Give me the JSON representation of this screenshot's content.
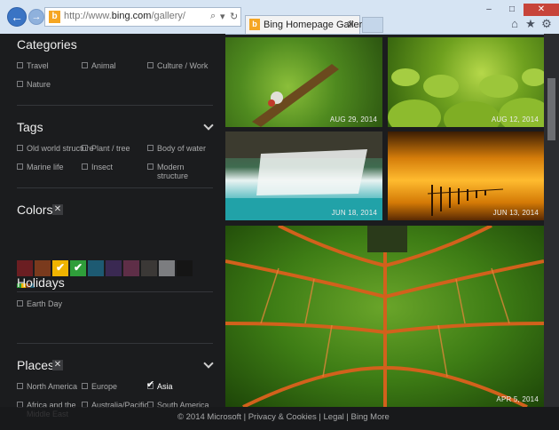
{
  "browser": {
    "address": {
      "prefix": "http://www.",
      "domain": "bing.com",
      "path": "/gallery/"
    },
    "tab_title": "Bing Homepage Gallery",
    "tab_favicon": "b",
    "address_favicon": "b",
    "back_glyph": "←",
    "forward_glyph": "→",
    "search_glyph": "⌕",
    "dropdown_glyph": "▾",
    "refresh_glyph": "↻",
    "close_tab_glyph": "✕",
    "window_buttons": {
      "minimize": "–",
      "maximize": "□",
      "close": "✕"
    },
    "toolbar_glyphs": {
      "home": "⌂",
      "favorites": "★",
      "settings": "⚙"
    }
  },
  "filters": {
    "categories": {
      "title": "Categories",
      "options": [
        "Travel",
        "Animal",
        "Culture / Work",
        "Nature"
      ]
    },
    "tags": {
      "title": "Tags",
      "options": [
        "Old world structure",
        "Plant / tree",
        "Body of water",
        "Marine life",
        "Insect",
        "Modern structure"
      ]
    },
    "colors": {
      "title": "Colors",
      "clear_glyph": "✕",
      "check_glyph": "✔",
      "swatches": [
        {
          "color": "#6b1e22",
          "selected": false
        },
        {
          "color": "#7a3a1d",
          "selected": false
        },
        {
          "color": "#f0b400",
          "selected": true
        },
        {
          "color": "#2f9e3a",
          "selected": true
        },
        {
          "color": "#1d5a72",
          "selected": false
        },
        {
          "color": "#3a2952",
          "selected": false
        },
        {
          "color": "#5e2e47",
          "selected": false
        },
        {
          "color": "#3b3836",
          "selected": false
        },
        {
          "color": "#7c7d80",
          "selected": false
        },
        {
          "color": "#151515",
          "selected": false
        }
      ]
    },
    "holidays": {
      "title": "Holidays",
      "options": [
        "Earth Day"
      ]
    },
    "places": {
      "title": "Places",
      "clear_glyph": "✕",
      "options": [
        {
          "label": "North America",
          "checked": false
        },
        {
          "label": "Europe",
          "checked": false
        },
        {
          "label": "Asia",
          "checked": true
        },
        {
          "label": "Africa and the Middle East",
          "checked": false
        },
        {
          "label": "Australia/Pacific",
          "checked": false
        },
        {
          "label": "South America",
          "checked": false
        }
      ],
      "check_glyph": "✔"
    }
  },
  "gallery": [
    {
      "date": "AUG 29, 2014"
    },
    {
      "date": "AUG 12, 2014"
    },
    {
      "date": "JUN 18, 2014"
    },
    {
      "date": "JUN 13, 2014"
    },
    {
      "date": "APR 5, 2014"
    }
  ],
  "footer": {
    "text": "© 2014 Microsoft | Privacy & Cookies | Legal | Bing More"
  }
}
